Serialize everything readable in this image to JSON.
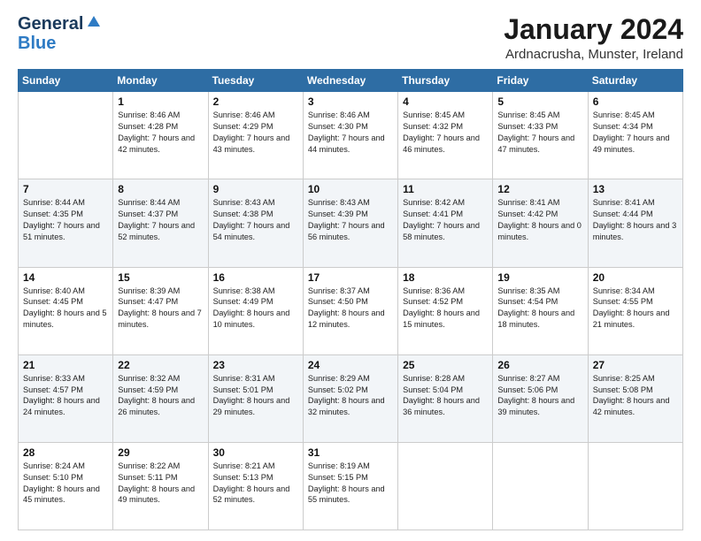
{
  "logo": {
    "line1": "General",
    "line2": "Blue"
  },
  "title": "January 2024",
  "subtitle": "Ardnacrusha, Munster, Ireland",
  "days_header": [
    "Sunday",
    "Monday",
    "Tuesday",
    "Wednesday",
    "Thursday",
    "Friday",
    "Saturday"
  ],
  "weeks": [
    [
      {
        "day": "",
        "sunrise": "",
        "sunset": "",
        "daylight": ""
      },
      {
        "day": "1",
        "sunrise": "Sunrise: 8:46 AM",
        "sunset": "Sunset: 4:28 PM",
        "daylight": "Daylight: 7 hours and 42 minutes."
      },
      {
        "day": "2",
        "sunrise": "Sunrise: 8:46 AM",
        "sunset": "Sunset: 4:29 PM",
        "daylight": "Daylight: 7 hours and 43 minutes."
      },
      {
        "day": "3",
        "sunrise": "Sunrise: 8:46 AM",
        "sunset": "Sunset: 4:30 PM",
        "daylight": "Daylight: 7 hours and 44 minutes."
      },
      {
        "day": "4",
        "sunrise": "Sunrise: 8:45 AM",
        "sunset": "Sunset: 4:32 PM",
        "daylight": "Daylight: 7 hours and 46 minutes."
      },
      {
        "day": "5",
        "sunrise": "Sunrise: 8:45 AM",
        "sunset": "Sunset: 4:33 PM",
        "daylight": "Daylight: 7 hours and 47 minutes."
      },
      {
        "day": "6",
        "sunrise": "Sunrise: 8:45 AM",
        "sunset": "Sunset: 4:34 PM",
        "daylight": "Daylight: 7 hours and 49 minutes."
      }
    ],
    [
      {
        "day": "7",
        "sunrise": "Sunrise: 8:44 AM",
        "sunset": "Sunset: 4:35 PM",
        "daylight": "Daylight: 7 hours and 51 minutes."
      },
      {
        "day": "8",
        "sunrise": "Sunrise: 8:44 AM",
        "sunset": "Sunset: 4:37 PM",
        "daylight": "Daylight: 7 hours and 52 minutes."
      },
      {
        "day": "9",
        "sunrise": "Sunrise: 8:43 AM",
        "sunset": "Sunset: 4:38 PM",
        "daylight": "Daylight: 7 hours and 54 minutes."
      },
      {
        "day": "10",
        "sunrise": "Sunrise: 8:43 AM",
        "sunset": "Sunset: 4:39 PM",
        "daylight": "Daylight: 7 hours and 56 minutes."
      },
      {
        "day": "11",
        "sunrise": "Sunrise: 8:42 AM",
        "sunset": "Sunset: 4:41 PM",
        "daylight": "Daylight: 7 hours and 58 minutes."
      },
      {
        "day": "12",
        "sunrise": "Sunrise: 8:41 AM",
        "sunset": "Sunset: 4:42 PM",
        "daylight": "Daylight: 8 hours and 0 minutes."
      },
      {
        "day": "13",
        "sunrise": "Sunrise: 8:41 AM",
        "sunset": "Sunset: 4:44 PM",
        "daylight": "Daylight: 8 hours and 3 minutes."
      }
    ],
    [
      {
        "day": "14",
        "sunrise": "Sunrise: 8:40 AM",
        "sunset": "Sunset: 4:45 PM",
        "daylight": "Daylight: 8 hours and 5 minutes."
      },
      {
        "day": "15",
        "sunrise": "Sunrise: 8:39 AM",
        "sunset": "Sunset: 4:47 PM",
        "daylight": "Daylight: 8 hours and 7 minutes."
      },
      {
        "day": "16",
        "sunrise": "Sunrise: 8:38 AM",
        "sunset": "Sunset: 4:49 PM",
        "daylight": "Daylight: 8 hours and 10 minutes."
      },
      {
        "day": "17",
        "sunrise": "Sunrise: 8:37 AM",
        "sunset": "Sunset: 4:50 PM",
        "daylight": "Daylight: 8 hours and 12 minutes."
      },
      {
        "day": "18",
        "sunrise": "Sunrise: 8:36 AM",
        "sunset": "Sunset: 4:52 PM",
        "daylight": "Daylight: 8 hours and 15 minutes."
      },
      {
        "day": "19",
        "sunrise": "Sunrise: 8:35 AM",
        "sunset": "Sunset: 4:54 PM",
        "daylight": "Daylight: 8 hours and 18 minutes."
      },
      {
        "day": "20",
        "sunrise": "Sunrise: 8:34 AM",
        "sunset": "Sunset: 4:55 PM",
        "daylight": "Daylight: 8 hours and 21 minutes."
      }
    ],
    [
      {
        "day": "21",
        "sunrise": "Sunrise: 8:33 AM",
        "sunset": "Sunset: 4:57 PM",
        "daylight": "Daylight: 8 hours and 24 minutes."
      },
      {
        "day": "22",
        "sunrise": "Sunrise: 8:32 AM",
        "sunset": "Sunset: 4:59 PM",
        "daylight": "Daylight: 8 hours and 26 minutes."
      },
      {
        "day": "23",
        "sunrise": "Sunrise: 8:31 AM",
        "sunset": "Sunset: 5:01 PM",
        "daylight": "Daylight: 8 hours and 29 minutes."
      },
      {
        "day": "24",
        "sunrise": "Sunrise: 8:29 AM",
        "sunset": "Sunset: 5:02 PM",
        "daylight": "Daylight: 8 hours and 32 minutes."
      },
      {
        "day": "25",
        "sunrise": "Sunrise: 8:28 AM",
        "sunset": "Sunset: 5:04 PM",
        "daylight": "Daylight: 8 hours and 36 minutes."
      },
      {
        "day": "26",
        "sunrise": "Sunrise: 8:27 AM",
        "sunset": "Sunset: 5:06 PM",
        "daylight": "Daylight: 8 hours and 39 minutes."
      },
      {
        "day": "27",
        "sunrise": "Sunrise: 8:25 AM",
        "sunset": "Sunset: 5:08 PM",
        "daylight": "Daylight: 8 hours and 42 minutes."
      }
    ],
    [
      {
        "day": "28",
        "sunrise": "Sunrise: 8:24 AM",
        "sunset": "Sunset: 5:10 PM",
        "daylight": "Daylight: 8 hours and 45 minutes."
      },
      {
        "day": "29",
        "sunrise": "Sunrise: 8:22 AM",
        "sunset": "Sunset: 5:11 PM",
        "daylight": "Daylight: 8 hours and 49 minutes."
      },
      {
        "day": "30",
        "sunrise": "Sunrise: 8:21 AM",
        "sunset": "Sunset: 5:13 PM",
        "daylight": "Daylight: 8 hours and 52 minutes."
      },
      {
        "day": "31",
        "sunrise": "Sunrise: 8:19 AM",
        "sunset": "Sunset: 5:15 PM",
        "daylight": "Daylight: 8 hours and 55 minutes."
      },
      {
        "day": "",
        "sunrise": "",
        "sunset": "",
        "daylight": ""
      },
      {
        "day": "",
        "sunrise": "",
        "sunset": "",
        "daylight": ""
      },
      {
        "day": "",
        "sunrise": "",
        "sunset": "",
        "daylight": ""
      }
    ]
  ]
}
